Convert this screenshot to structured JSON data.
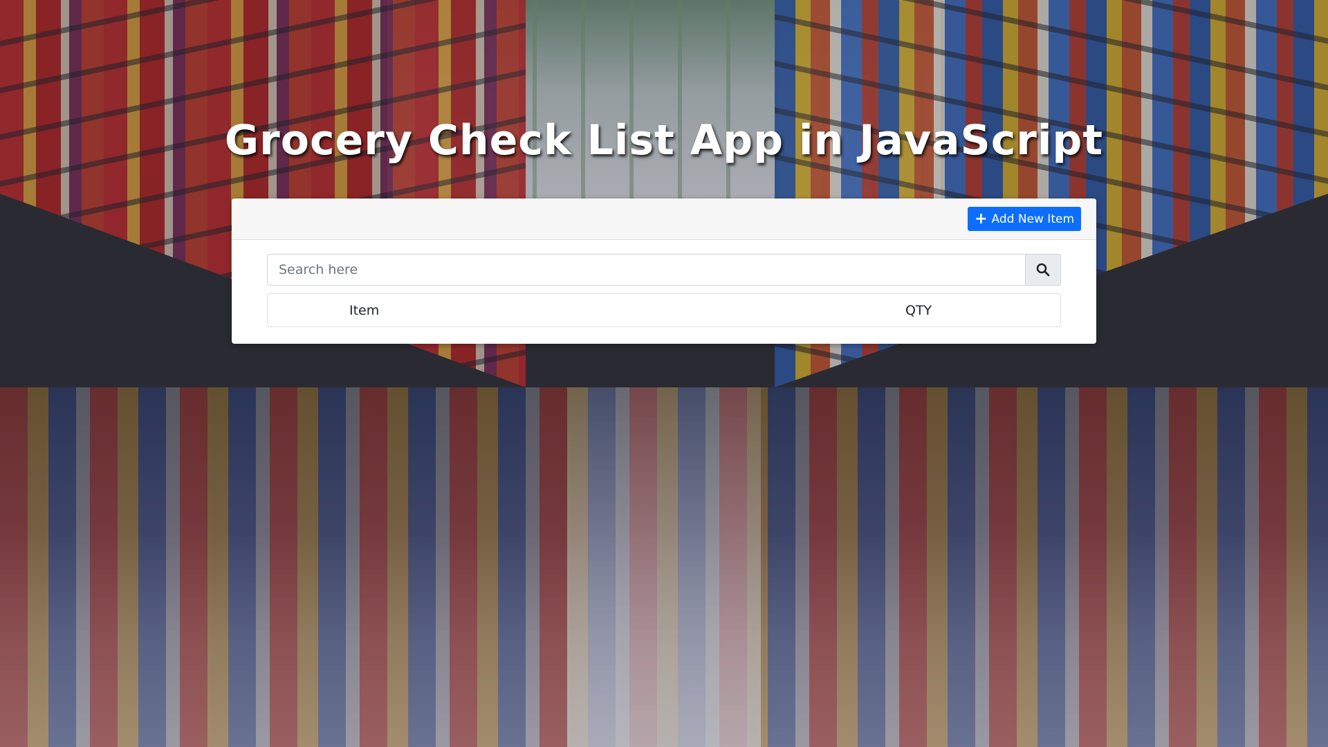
{
  "page": {
    "title": "Grocery Check List App in JavaScript"
  },
  "header": {
    "add_button_label": "Add New Item",
    "add_button_icon": "plus-icon"
  },
  "search": {
    "placeholder": "Search here",
    "value": "",
    "button_icon": "search-icon"
  },
  "table": {
    "columns": [
      "Item",
      "QTY"
    ],
    "rows": []
  },
  "colors": {
    "accent": "#0d6efd",
    "title": "#ffffff",
    "card_header": "#f7f7f7"
  }
}
